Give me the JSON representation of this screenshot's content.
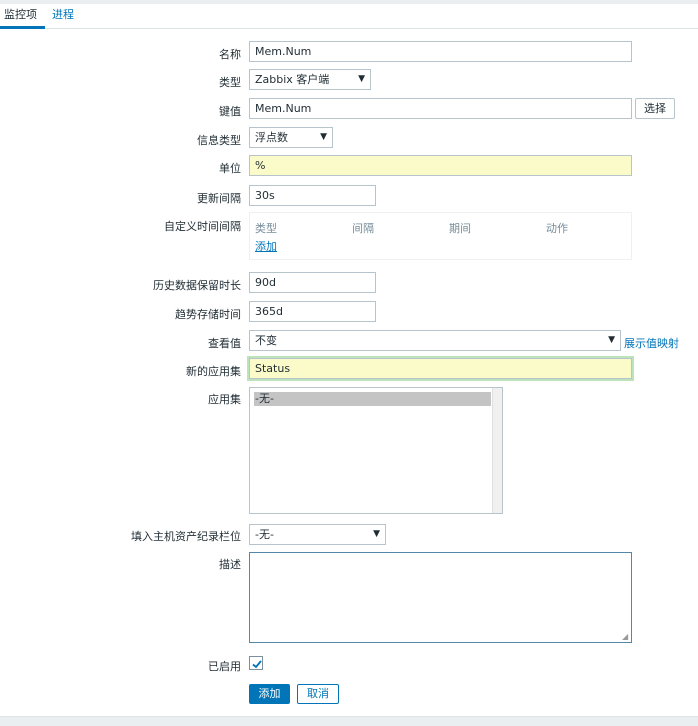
{
  "tabs": [
    {
      "label": "监控项",
      "active": true
    },
    {
      "label": "进程",
      "active": false
    }
  ],
  "form": {
    "name": {
      "label": "名称",
      "value": "Mem.Num"
    },
    "type": {
      "label": "类型",
      "value": "Zabbix 客户端"
    },
    "key": {
      "label": "键值",
      "value": "Mem.Num",
      "button": "选择"
    },
    "info_type": {
      "label": "信息类型",
      "value": "浮点数"
    },
    "units": {
      "label": "单位",
      "value": "%"
    },
    "update_interval": {
      "label": "更新间隔",
      "value": "30s"
    },
    "custom_intervals": {
      "label": "自定义时间间隔",
      "headers": [
        "类型",
        "间隔",
        "期间",
        "动作"
      ],
      "add_link": "添加"
    },
    "history": {
      "label": "历史数据保留时长",
      "value": "90d"
    },
    "trends": {
      "label": "趋势存储时间",
      "value": "365d"
    },
    "valuemap": {
      "label": "查看值",
      "value": "不变",
      "link": "展示值映射"
    },
    "new_application": {
      "label": "新的应用集",
      "value": "Status"
    },
    "applications": {
      "label": "应用集",
      "options": [
        "-无-"
      ]
    },
    "inventory": {
      "label": "填入主机资产纪录栏位",
      "value": "-无-"
    },
    "description": {
      "label": "描述",
      "value": ""
    },
    "enabled": {
      "label": "已启用",
      "checked": true
    }
  },
  "actions": {
    "add": "添加",
    "cancel": "取消"
  },
  "colors": {
    "accent": "#0275b8",
    "highlight_field": "#fbfbc9",
    "focus_ring": "#bde3bd"
  }
}
